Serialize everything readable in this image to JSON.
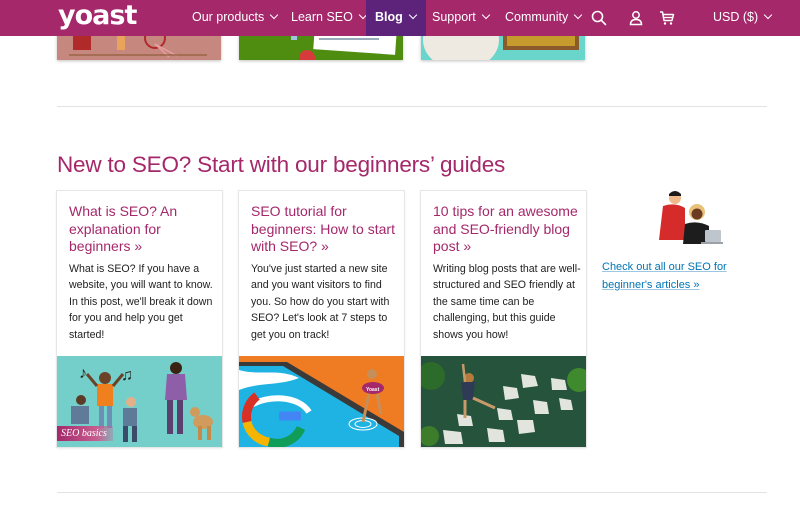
{
  "nav": {
    "logo": "yoast",
    "items": [
      {
        "label": "Our products",
        "has_dropdown": true
      },
      {
        "label": "Learn SEO",
        "has_dropdown": true
      },
      {
        "label": "Blog",
        "has_dropdown": true,
        "active": true
      },
      {
        "label": "Support",
        "has_dropdown": true
      },
      {
        "label": "Community",
        "has_dropdown": true
      }
    ],
    "icons": [
      "search-icon",
      "user-icon",
      "cart-icon"
    ],
    "currency": "USD ($)",
    "colors": {
      "bar": "#a4286a",
      "active": "#5d237a"
    }
  },
  "section": {
    "title": "New to SEO? Start with our beginners’ guides",
    "cards": [
      {
        "title": "What is SEO? An explanation for beginners »",
        "text": "What is SEO? If you have a website, you will want to know. In this post, we'll break it down for you and help you get started!",
        "badge": "SEO basics",
        "image": "people dancing with music notes and a dog"
      },
      {
        "title": "SEO tutorial for beginners: How to start with SEO? »",
        "text": "You've just started a new site and you want visitors to find you. So how do you start with SEO? Let's look at 7 steps to get you on track!",
        "image": "person with Yoast float ring dipping toe in pool with Google G"
      },
      {
        "title": "10 tips for an awesome and SEO-friendly blog post »",
        "text": "Writing blog posts that are well-structured and SEO friendly at the same time can be challenging, but this guide shows you how!",
        "image": "person walking on stepping stones across a stream"
      }
    ],
    "side_link": "Check out all our SEO for beginner's articles »"
  }
}
